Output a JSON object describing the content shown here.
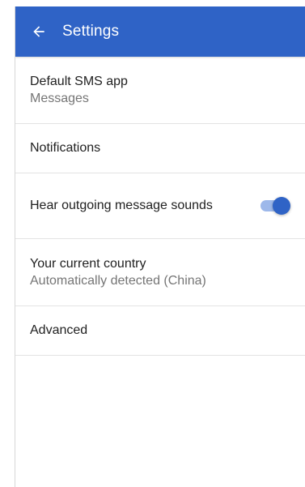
{
  "app_bar": {
    "title": "Settings",
    "back_icon": "arrow-back-icon",
    "color": "#2f63c6"
  },
  "settings": {
    "default_sms": {
      "title": "Default SMS app",
      "value": "Messages"
    },
    "notifications": {
      "title": "Notifications"
    },
    "outgoing_sounds": {
      "title": "Hear outgoing message sounds",
      "enabled": true
    },
    "current_country": {
      "title": "Your current country",
      "value": "Automatically detected (China)"
    },
    "advanced": {
      "title": "Advanced"
    }
  },
  "colors": {
    "accent": "#2f63c6",
    "switch_track": "#9db8ea",
    "primary_text": "#212121",
    "secondary_text": "#757575",
    "divider": "#e3e3e3"
  }
}
